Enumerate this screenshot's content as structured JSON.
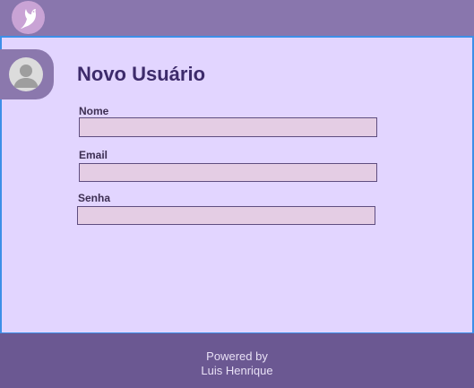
{
  "header": {
    "logo_icon": "bird-logo-icon"
  },
  "form": {
    "avatar_icon": "user-avatar-icon",
    "title": "Novo Usuário",
    "fields": [
      {
        "label": "Nome",
        "value": "",
        "placeholder": ""
      },
      {
        "label": "Email",
        "value": "",
        "placeholder": ""
      },
      {
        "label": "Senha",
        "value": "",
        "placeholder": ""
      }
    ]
  },
  "footer": {
    "line1": "Powered by",
    "line2": "Luis Henrique"
  },
  "colors": {
    "header_bg": "#8976ad",
    "panel_bg": "#e2d5ff",
    "panel_border": "#3d8fe8",
    "title_text": "#3d2b6b",
    "input_bg": "#e4cde4",
    "footer_bg": "#6b5892"
  }
}
